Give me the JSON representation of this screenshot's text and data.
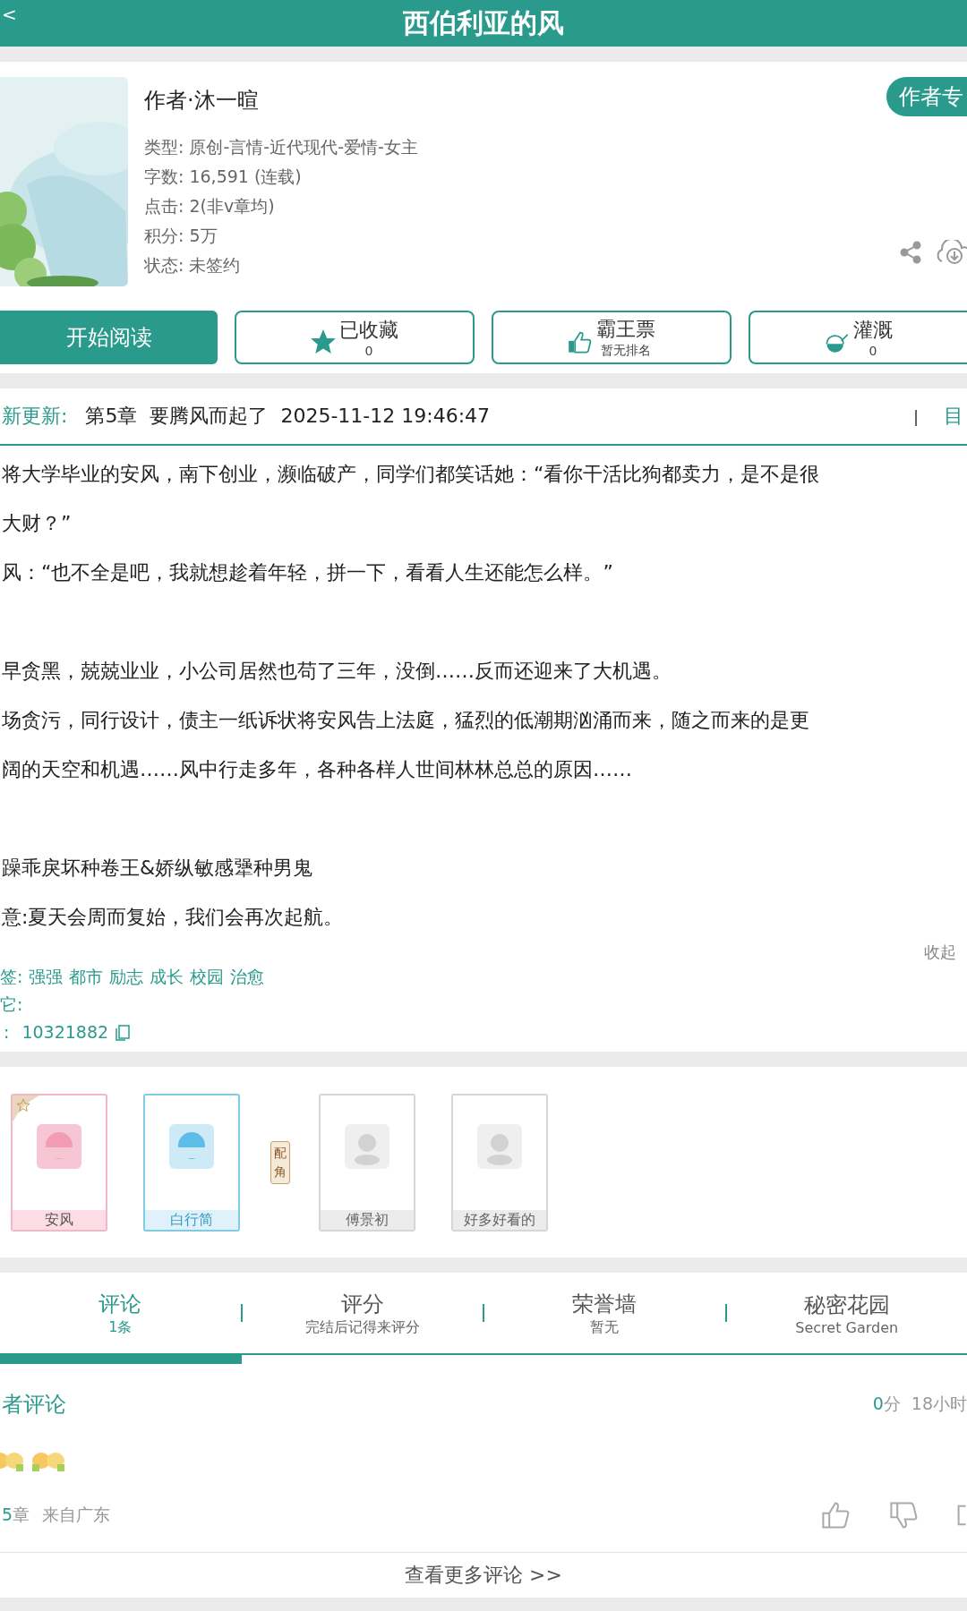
{
  "header": {
    "back": "<",
    "title": "西伯利亚的风"
  },
  "book": {
    "author": "作者·沐一暄",
    "author_button": "作者专",
    "meta": [
      "类型: 原创-言情-近代现代-爱情-女主",
      "字数: 16,591 (连载)",
      "点击: 2(非v章均)",
      "积分: 5万",
      "状态: 未签约"
    ]
  },
  "actions": [
    {
      "kind": "primary",
      "label": "开始阅读"
    },
    {
      "kind": "favorite",
      "label": "已收藏",
      "sub": "0",
      "on": true
    },
    {
      "kind": "vote",
      "label": "霸王票",
      "sub": "暂无排名"
    },
    {
      "kind": "water",
      "label": "灌溉",
      "sub": "0"
    }
  ],
  "latest": {
    "label": "新更新:",
    "chapter": "第5章  要腾风而起了  2025-11-12 19:46:47",
    "divider": "|",
    "toc": "目"
  },
  "synopsis": [
    [
      "将大学毕业的安风，南下创业，濒临破产，同学们都笑话她：“看你干活比狗都卖力，是不是很",
      "大财？”",
      "风：“也不全是吧，我就想趁着年轻，拼一下，看看人生还能怎么样。”"
    ],
    [
      "早贪黑，兢兢业业，小公司居然也苟了三年，没倒……反而还迎来了大机遇。",
      "场贪污，同行设计，债主一纸诉状将安风告上法庭，猛烈的低潮期汹涌而来，随之而来的是更",
      "阔的天空和机遇……风中行走多年，各种各样人世间林林总总的原因……"
    ],
    [
      "躁乖戾坏种卷王&娇纵敏感犟种男鬼",
      "意:夏天会周而复始，我们会再次起航。"
    ]
  ],
  "collapse": "收起",
  "tags": {
    "label": "签:",
    "items": [
      "强强",
      "都市",
      "励志",
      "成长",
      "校园",
      "治愈"
    ],
    "other_label": "它:",
    "id_label": ":",
    "id": "10321882"
  },
  "characters": {
    "main": [
      {
        "name": "安风",
        "kind": "female",
        "starred": true
      },
      {
        "name": "白行简",
        "kind": "male",
        "starred": false
      }
    ],
    "supporting_label": "配角",
    "supporting": [
      {
        "name": "傅景初",
        "kind": "blank"
      },
      {
        "name": "好多好看的",
        "kind": "blank"
      }
    ]
  },
  "tabs": [
    {
      "label": "评论",
      "sub": "1条",
      "selected": true
    },
    {
      "label": "评分",
      "sub": "完结后记得来评分",
      "selected": false
    },
    {
      "label": "荣誉墙",
      "sub": "暂无",
      "selected": false
    },
    {
      "label": "秘密花园",
      "sub": "Secret Garden",
      "selected": false
    }
  ],
  "comment": {
    "title": "者评论",
    "score": "0",
    "score_unit": "分",
    "time": "18小时",
    "chapter_num": "5",
    "chapter_unit": "章",
    "location": "来自广东"
  },
  "more": "查看更多评论 >>"
}
